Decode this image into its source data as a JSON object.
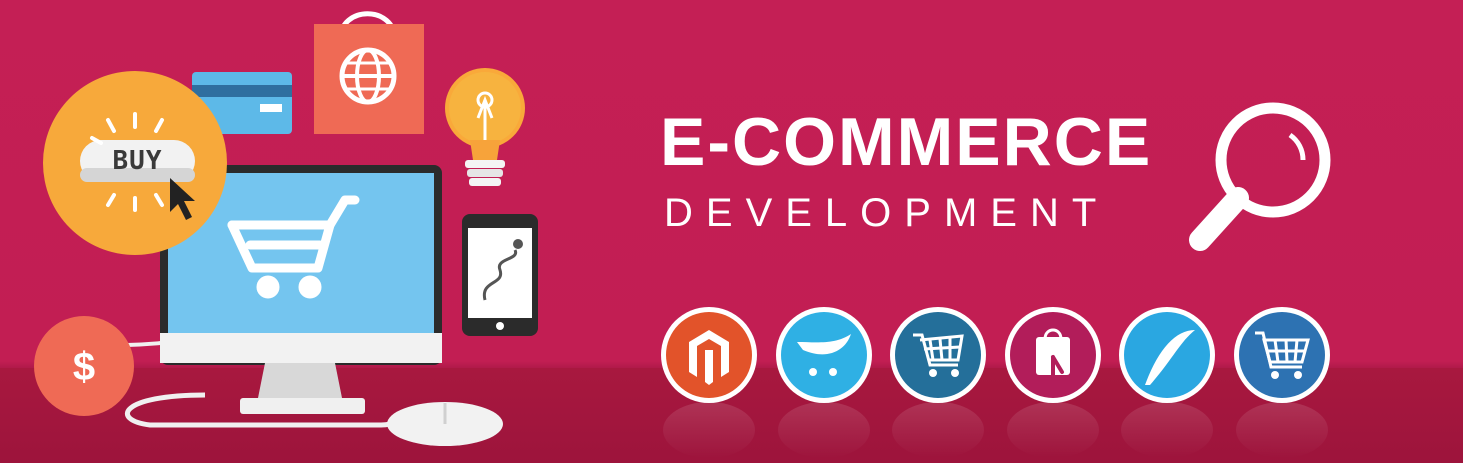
{
  "banner": {
    "title": "E-COMMERCE",
    "subtitle": "DEVELOPMENT"
  },
  "illustration": {
    "buy_label": "BUY",
    "currency_symbol": "$"
  },
  "platform_icons": [
    {
      "icon": "magento-icon",
      "color": "#e2532a"
    },
    {
      "icon": "opencart-icon",
      "color": "#2fb0e4"
    },
    {
      "icon": "oscommerce-cart-icon",
      "color": "#246f9a"
    },
    {
      "icon": "prestashop-bag-icon",
      "color": "#b21d5a"
    },
    {
      "icon": "swift-wing-icon",
      "color": "#2aa7e1"
    },
    {
      "icon": "shopping-cart-icon",
      "color": "#2d72b2"
    }
  ],
  "colors": {
    "background": "#c21e53",
    "accent_orange": "#f7a93b",
    "accent_coral": "#ef6a55",
    "screen_blue": "#74c5ef",
    "white": "#ffffff"
  }
}
